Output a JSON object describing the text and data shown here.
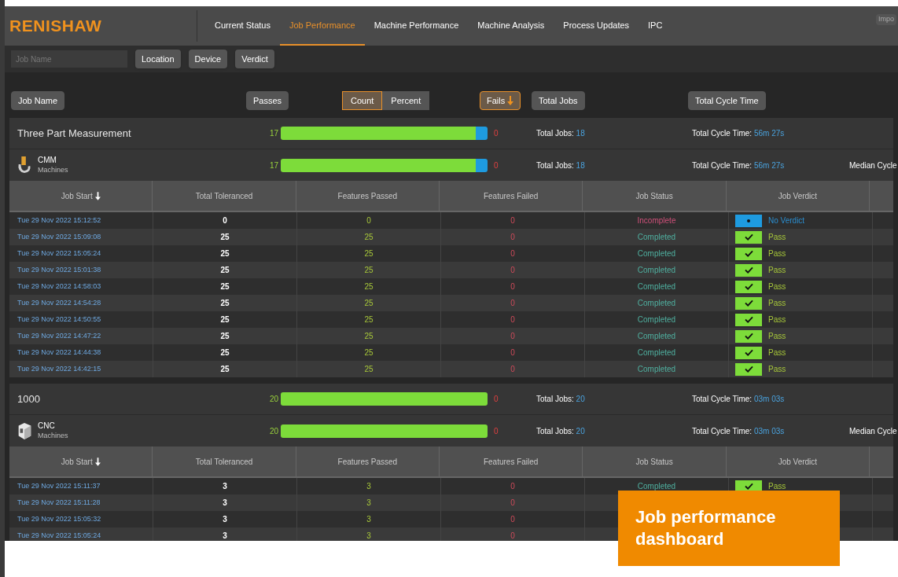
{
  "nav": {
    "logo": "RENISHAW",
    "tabs": [
      {
        "label": "Current Status",
        "selected": false
      },
      {
        "label": "Job Performance",
        "selected": true
      },
      {
        "label": "Machine Performance",
        "selected": false
      },
      {
        "label": "Machine Analysis",
        "selected": false
      },
      {
        "label": "Process Updates",
        "selected": false
      },
      {
        "label": "IPC",
        "selected": false
      }
    ],
    "corner": "Impo"
  },
  "filters": {
    "search": {
      "placeholder": "Job Name"
    },
    "buttons": [
      "Location",
      "Device",
      "Verdict"
    ]
  },
  "sort_bar": [
    {
      "kind": "button",
      "label": "Job Name",
      "selected": false
    },
    {
      "kind": "button",
      "label": "Passes",
      "selected": false
    },
    {
      "kind": "toggle",
      "options": [
        {
          "label": "Count",
          "selected": true
        },
        {
          "label": "Percent",
          "selected": false
        }
      ]
    },
    {
      "kind": "button",
      "label": "Fails",
      "selected": true,
      "sorted": true
    },
    {
      "kind": "button",
      "label": "Total Jobs",
      "selected": false
    },
    {
      "kind": "button",
      "label": "Total Cycle Time",
      "selected": false
    }
  ],
  "groups": [
    {
      "name": "Three Part Measurement",
      "summary": {
        "passed": "17",
        "failed": "0",
        "jobs_label": "Total Jobs:",
        "jobs": "18",
        "cycle_label": "Total Cycle Time:",
        "cycle": "56m 27s"
      },
      "machine": {
        "kind": "cmm",
        "name": "CMM",
        "subtitle": "Machines",
        "passed": "17",
        "failed": "0",
        "jobs_label": "Total Jobs:",
        "jobs": "18",
        "cycle_label": "Total Cycle Time:",
        "cycle": "56m 27s",
        "median_label": "Median Cycle"
      },
      "columns": [
        "Job Start",
        "Total Toleranced",
        "Features Passed",
        "Features Failed",
        "Job Status",
        "Job Verdict"
      ],
      "rows": [
        {
          "kind": "incomplete",
          "start": "Tue 29 Nov 2022 15:12:52",
          "toleranced": "0",
          "passed": "0",
          "failed": "0",
          "status": "Incomplete",
          "verdict": "No Verdict"
        },
        {
          "kind": "completed",
          "start": "Tue 29 Nov 2022 15:09:08",
          "toleranced": "25",
          "passed": "25",
          "failed": "0",
          "status": "Completed",
          "verdict": "Pass"
        },
        {
          "kind": "completed",
          "start": "Tue 29 Nov 2022 15:05:24",
          "toleranced": "25",
          "passed": "25",
          "failed": "0",
          "status": "Completed",
          "verdict": "Pass"
        },
        {
          "kind": "completed",
          "start": "Tue 29 Nov 2022 15:01:38",
          "toleranced": "25",
          "passed": "25",
          "failed": "0",
          "status": "Completed",
          "verdict": "Pass"
        },
        {
          "kind": "completed",
          "start": "Tue 29 Nov 2022 14:58:03",
          "toleranced": "25",
          "passed": "25",
          "failed": "0",
          "status": "Completed",
          "verdict": "Pass"
        },
        {
          "kind": "completed",
          "start": "Tue 29 Nov 2022 14:54:28",
          "toleranced": "25",
          "passed": "25",
          "failed": "0",
          "status": "Completed",
          "verdict": "Pass"
        },
        {
          "kind": "completed",
          "start": "Tue 29 Nov 2022 14:50:55",
          "toleranced": "25",
          "passed": "25",
          "failed": "0",
          "status": "Completed",
          "verdict": "Pass"
        },
        {
          "kind": "completed",
          "start": "Tue 29 Nov 2022 14:47:22",
          "toleranced": "25",
          "passed": "25",
          "failed": "0",
          "status": "Completed",
          "verdict": "Pass"
        },
        {
          "kind": "completed",
          "start": "Tue 29 Nov 2022 14:44:38",
          "toleranced": "25",
          "passed": "25",
          "failed": "0",
          "status": "Completed",
          "verdict": "Pass"
        },
        {
          "kind": "completed",
          "start": "Tue 29 Nov 2022 14:42:15",
          "toleranced": "25",
          "passed": "25",
          "failed": "0",
          "status": "Completed",
          "verdict": "Pass"
        }
      ]
    },
    {
      "name": "1000",
      "summary": {
        "passed": "20",
        "failed": "0",
        "jobs_label": "Total Jobs:",
        "jobs": "20",
        "cycle_label": "Total Cycle Time:",
        "cycle": "03m 03s"
      },
      "machine": {
        "kind": "cnc",
        "name": "CNC",
        "subtitle": "Machines",
        "passed": "20",
        "failed": "0",
        "jobs_label": "Total Jobs:",
        "jobs": "20",
        "cycle_label": "Total Cycle Time:",
        "cycle": "03m 03s",
        "median_label": "Median Cycle"
      },
      "columns": [
        "Job Start",
        "Total Toleranced",
        "Features Passed",
        "Features Failed",
        "Job Status",
        "Job Verdict"
      ],
      "rows": [
        {
          "kind": "completed",
          "start": "Tue 29 Nov 2022 15:11:37",
          "toleranced": "3",
          "passed": "3",
          "failed": "0",
          "status": "Completed",
          "verdict": "Pass"
        },
        {
          "start": "Tue 29 Nov 2022 15:11:28",
          "toleranced": "3",
          "passed": "3",
          "failed": "0"
        },
        {
          "start": "Tue 29 Nov 2022 15:05:32",
          "toleranced": "3",
          "passed": "3",
          "failed": "0"
        },
        {
          "start": "Tue 29 Nov 2022 15:05:24",
          "toleranced": "3",
          "passed": "3",
          "failed": "0"
        }
      ]
    }
  ],
  "caption": "Job performance dashboard"
}
